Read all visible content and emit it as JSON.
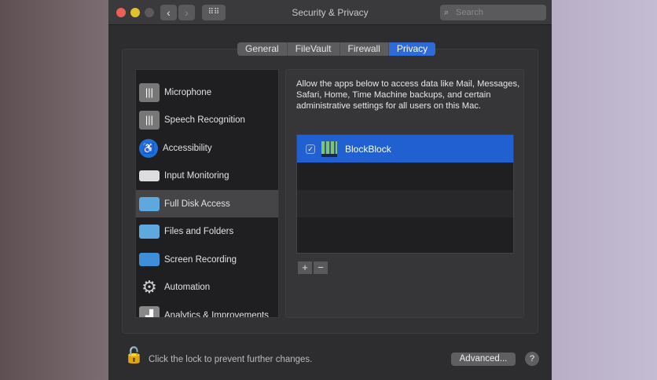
{
  "window": {
    "title": "Security & Privacy",
    "search_placeholder": "Search"
  },
  "tabs": [
    {
      "label": "General"
    },
    {
      "label": "FileVault"
    },
    {
      "label": "Firewall"
    },
    {
      "label": "Privacy"
    }
  ],
  "sidebar": {
    "items": [
      {
        "label": "Microphone"
      },
      {
        "label": "Speech Recognition"
      },
      {
        "label": "Accessibility"
      },
      {
        "label": "Input Monitoring"
      },
      {
        "label": "Full Disk Access"
      },
      {
        "label": "Files and Folders"
      },
      {
        "label": "Screen Recording"
      },
      {
        "label": "Automation"
      },
      {
        "label": "Analytics & Improvements"
      }
    ],
    "selected": "Full Disk Access"
  },
  "main": {
    "description": "Allow the apps below to access data like Mail, Messages, Safari, Home, Time Machine backups, and certain administrative settings for all users on this Mac.",
    "apps": [
      {
        "name": "BlockBlock",
        "checked": true
      }
    ],
    "add_label": "+",
    "remove_label": "−"
  },
  "footer": {
    "lock_text": "Click the lock to prevent further changes.",
    "advanced_label": "Advanced...",
    "help_label": "?"
  }
}
